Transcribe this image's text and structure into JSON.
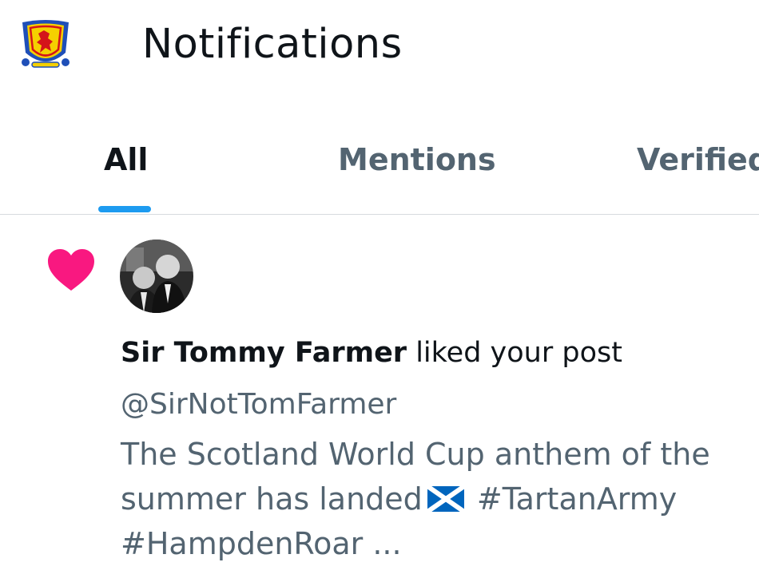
{
  "header": {
    "title": "Notifications",
    "logo_icon": "scotland-crest-icon"
  },
  "tabs": [
    {
      "label": "All",
      "active": true
    },
    {
      "label": "Mentions",
      "active": false
    },
    {
      "label": "Verified",
      "active": false
    }
  ],
  "colors": {
    "accent": "#1d9bf0",
    "like_heart": "#f91880",
    "secondary_text": "#536471",
    "primary_text": "#0f1419"
  },
  "notification": {
    "type_icon": "heart-icon",
    "avatar_icon": "user-avatar-photo",
    "actor_name": "Sir Tommy Farmer",
    "action_text": " liked your post",
    "handle": "@SirNotTomFarmer",
    "post_lines": [
      "The  Scotland World Cup anthem of the",
      "summer has landed",
      " #TartanArmy",
      "#HampdenRoar ..."
    ],
    "flag_icon": "scotland-flag-emoji"
  }
}
